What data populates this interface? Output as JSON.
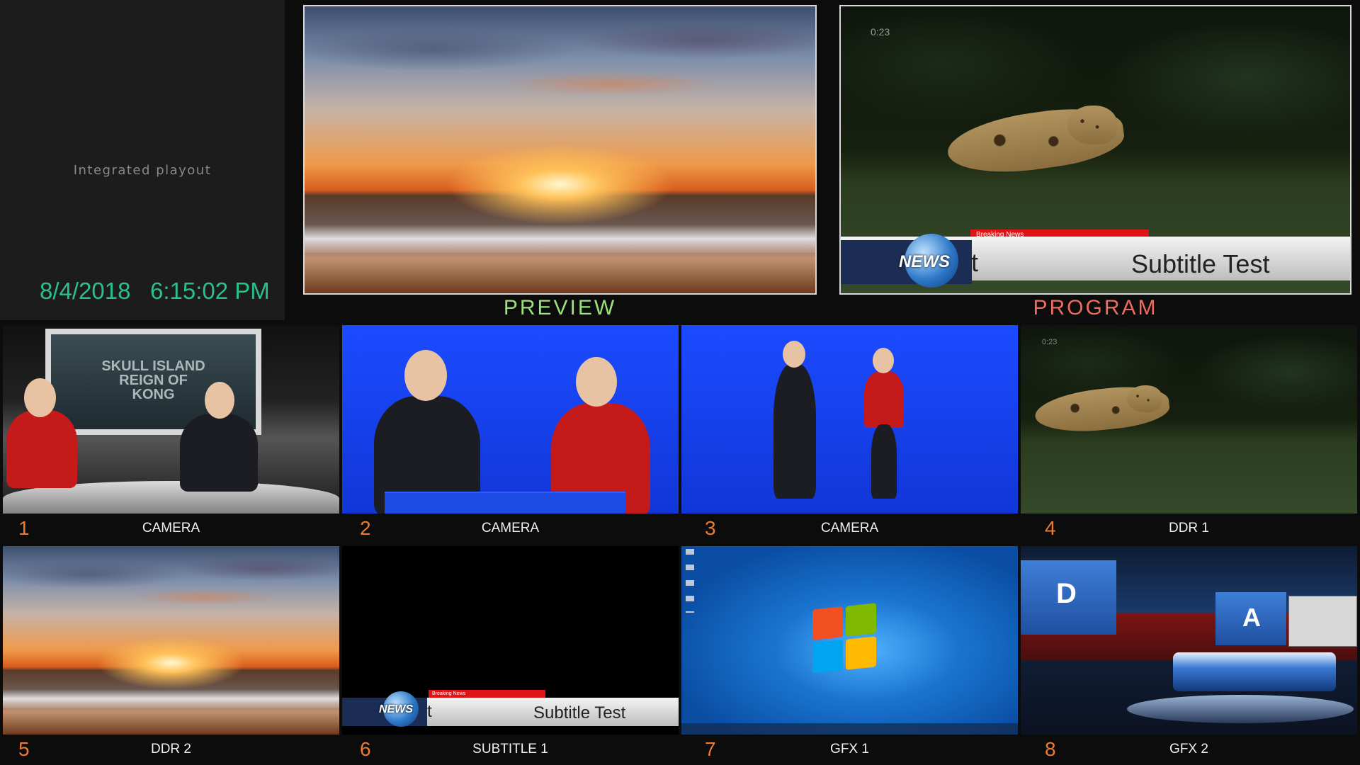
{
  "info": {
    "playout_label": "Integrated playout",
    "date": "8/4/2018",
    "time": "6:15:02 PM"
  },
  "preview": {
    "label": "PREVIEW"
  },
  "program": {
    "label": "PROGRAM",
    "timecode": "0:23",
    "lower_third": {
      "logo": "NEWS",
      "tag": "Breaking News",
      "prefix": "t",
      "title": "Subtitle Test"
    }
  },
  "sources": [
    {
      "number": "1",
      "name": "CAMERA",
      "content": "news-studio-anchors"
    },
    {
      "number": "2",
      "name": "CAMERA",
      "content": "bluescreen-seated-anchors"
    },
    {
      "number": "3",
      "name": "CAMERA",
      "content": "bluescreen-standing-anchors"
    },
    {
      "number": "4",
      "name": "DDR 1",
      "content": "cheetah-clip"
    },
    {
      "number": "5",
      "name": "DDR 2",
      "content": "sunset-beach"
    },
    {
      "number": "6",
      "name": "SUBTITLE 1",
      "content": "lower-third"
    },
    {
      "number": "7",
      "name": "GFX 1",
      "content": "windows-desktop"
    },
    {
      "number": "8",
      "name": "GFX 2",
      "content": "virtual-studio"
    }
  ],
  "thumb_text": {
    "studio_screen": "SKULL ISLAND\nREIGN OF\nKONG",
    "lt_logo": "NEWS",
    "lt_tag": "Breaking News",
    "lt_prefix": "t",
    "lt_title": "Subtitle Test",
    "vs_left": "D",
    "vs_right": "A",
    "cheetah_timecode": "0:23"
  },
  "colors": {
    "clock": "#2bc08a",
    "preview_label": "#9be27a",
    "program_label": "#ef6b5f",
    "source_number": "#ee7b32"
  }
}
